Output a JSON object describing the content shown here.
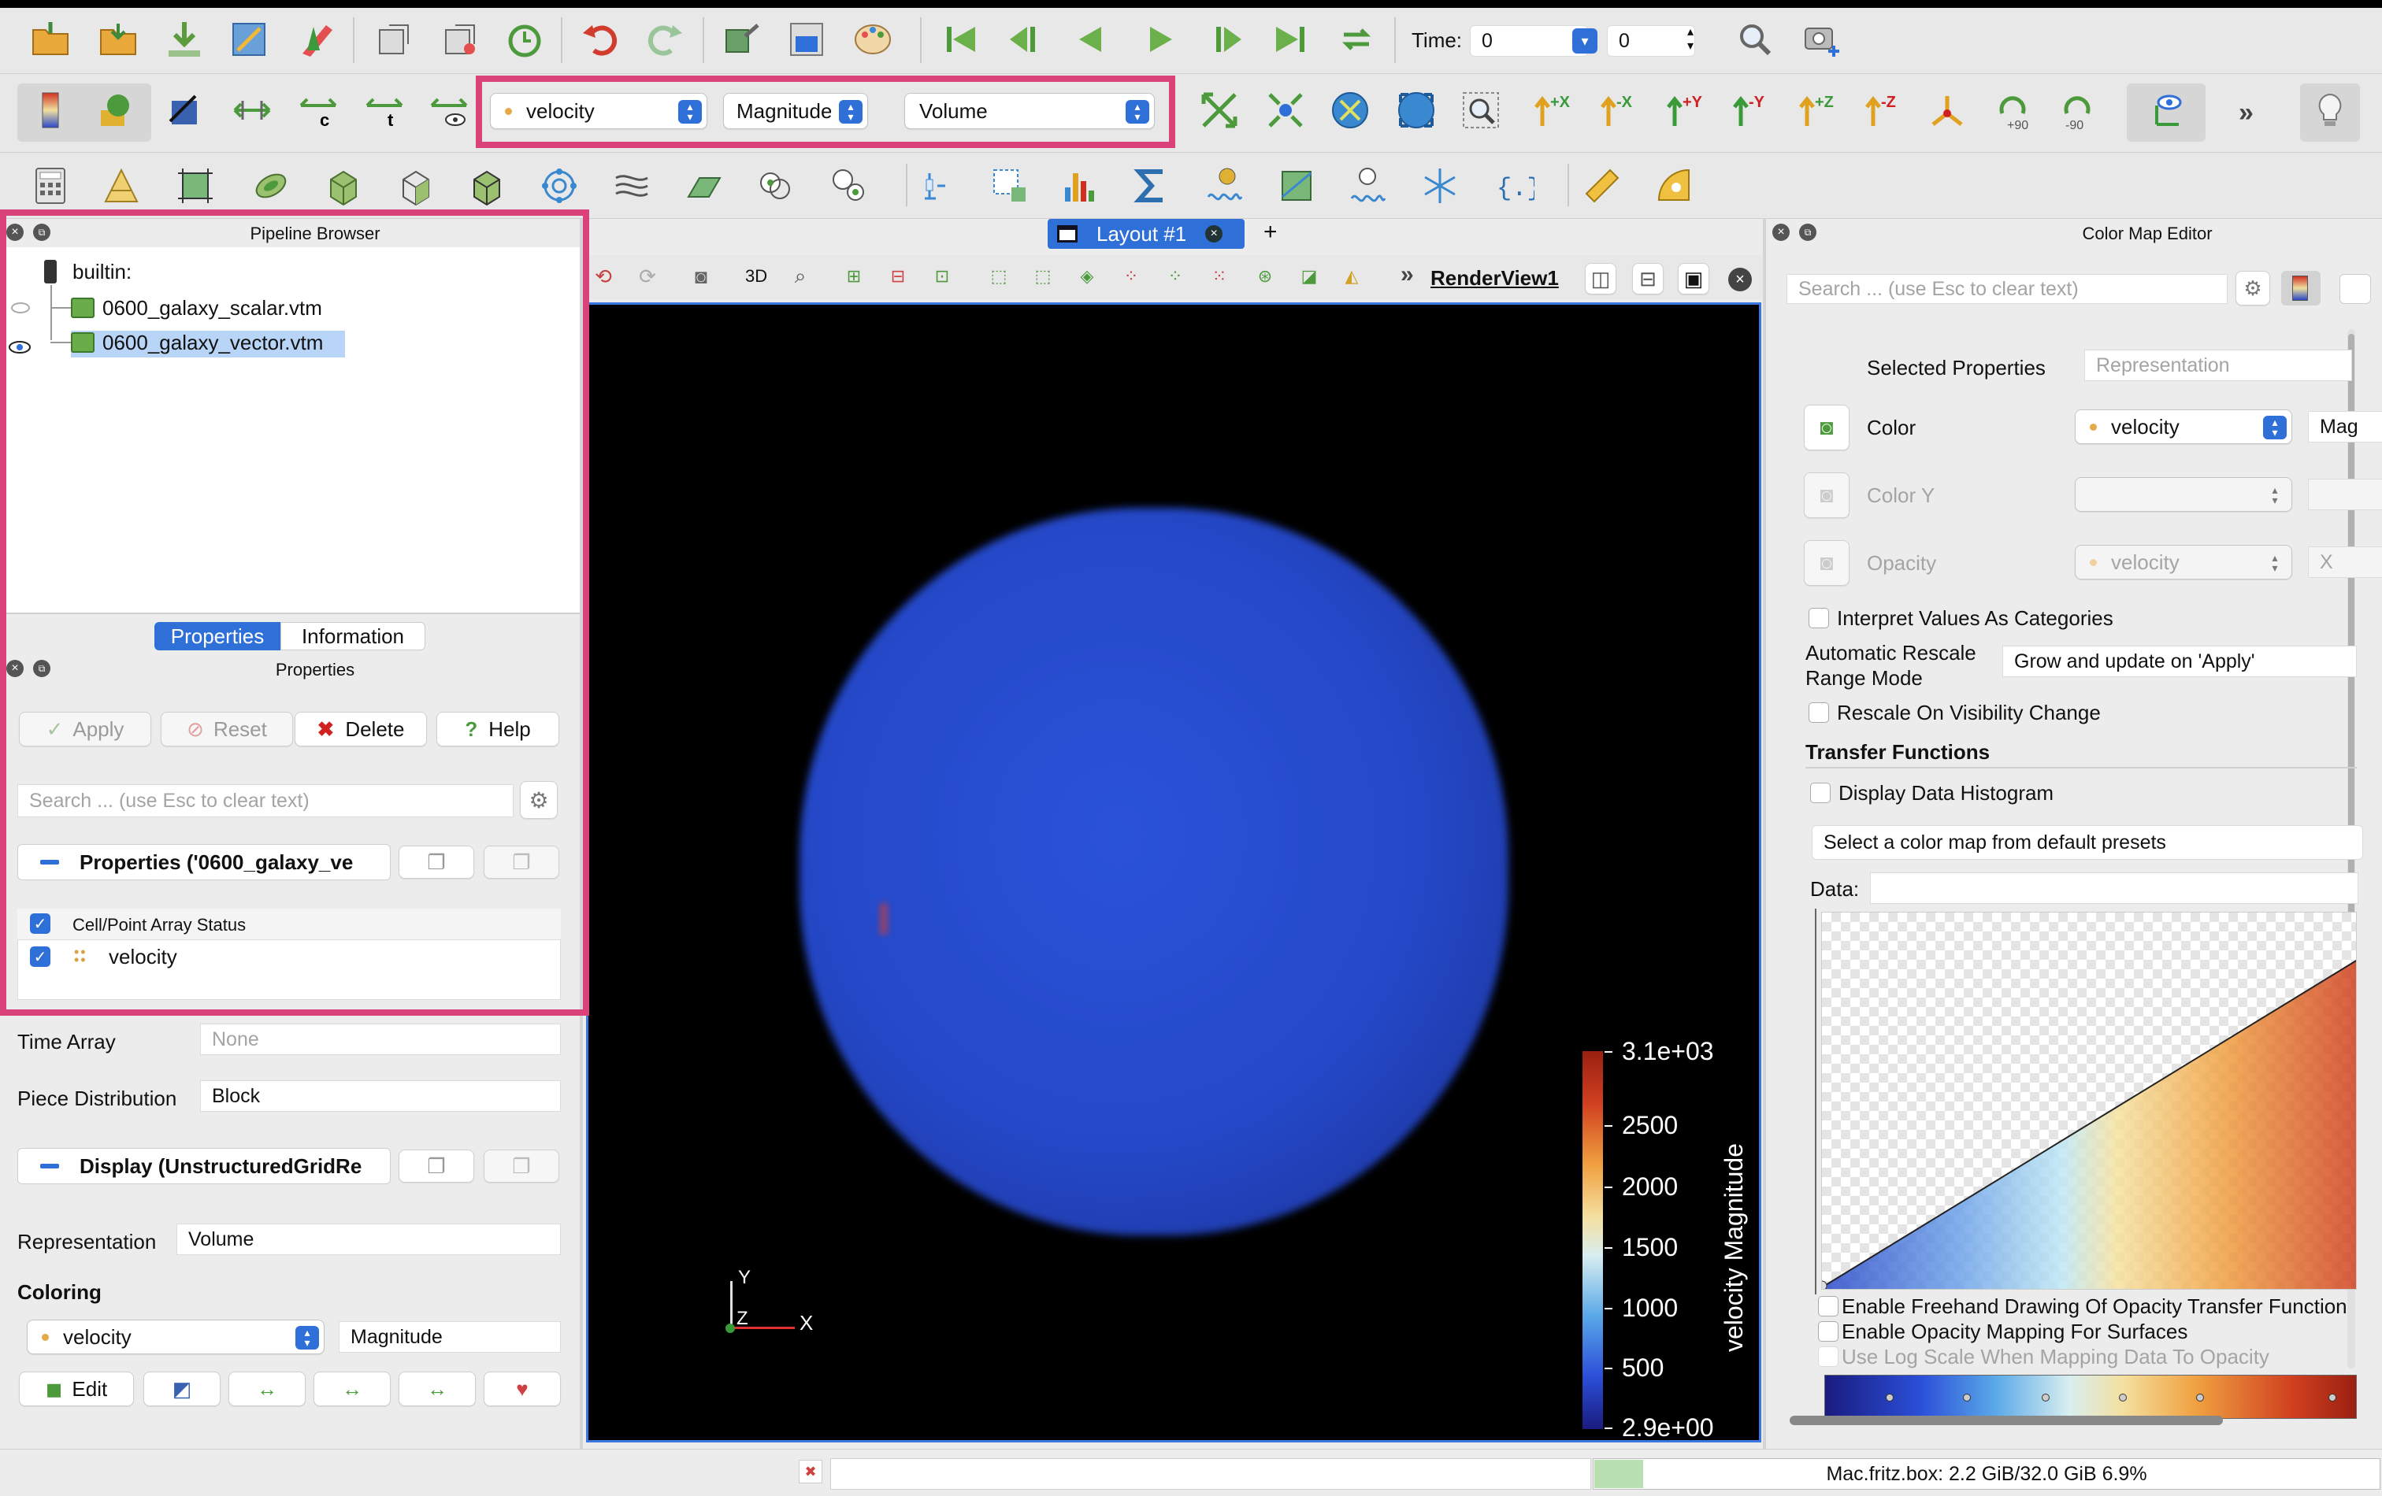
{
  "toolbar1": {
    "time_label": "Time:",
    "time_value": "0",
    "time_index": "0"
  },
  "toolbar2": {
    "array_combo": "velocity",
    "component_combo": "Magnitude",
    "representation_combo": "Volume"
  },
  "pipeline": {
    "title": "Pipeline Browser",
    "root": "builtin:",
    "items": [
      "0600_galaxy_scalar.vtm",
      "0600_galaxy_vector.vtm"
    ]
  },
  "tabs": [
    "Properties",
    "Information"
  ],
  "properties": {
    "title": "Properties",
    "apply": "Apply",
    "reset": "Reset",
    "delete": "Delete",
    "help": "Help",
    "search_placeholder": "Search ... (use Esc to clear text)",
    "section_header": "Properties ('0600_galaxy_ve",
    "array_status_header": "Cell/Point Array Status",
    "array_item": "velocity",
    "time_array_label": "Time Array",
    "time_array_value": "None",
    "piece_label": "Piece Distribution",
    "piece_value": "Block",
    "display_header": "Display (UnstructuredGridRe",
    "representation_label": "Representation",
    "representation_value": "Volume",
    "coloring_label": "Coloring",
    "coloring_array": "velocity",
    "coloring_component": "Magnitude",
    "edit_label": "Edit"
  },
  "layout": {
    "tab_label": "Layout #1",
    "add": "+",
    "view_toggle": "3D",
    "view_name": "RenderView1"
  },
  "colorbar": {
    "title": "velocity Magnitude",
    "ticks": [
      "3.1e+03",
      "2500",
      "2000",
      "1500",
      "1000",
      "500",
      "2.9e+00"
    ]
  },
  "axes": {
    "y": "Y",
    "z": "Z",
    "x": "X"
  },
  "cme": {
    "title": "Color Map Editor",
    "search_placeholder": "Search ... (use Esc to clear text)",
    "selected_properties": "Selected Properties",
    "representation_header": "Representation",
    "color_label": "Color",
    "color_value": "velocity",
    "color_component": "Mag",
    "color_y_label": "Color Y",
    "opacity_label": "Opacity",
    "opacity_value": "velocity",
    "opacity_component": "X",
    "interpret": "Interpret Values As Categories",
    "auto_rescale_1": "Automatic Rescale",
    "auto_rescale_2": "Range Mode",
    "auto_rescale_value": "Grow and update on 'Apply'",
    "rescale_visibility": "Rescale On Visibility Change",
    "transfer_functions": "Transfer Functions",
    "display_histogram": "Display Data Histogram",
    "preset": "Select a color map from default presets",
    "data_label": "Data:",
    "freehand": "Enable Freehand Drawing Of Opacity Transfer Function",
    "opacity_surfaces": "Enable Opacity Mapping For Surfaces",
    "log_scale": "Use Log Scale When Mapping Data To Opacity"
  },
  "status": {
    "memory": "Mac.fritz.box: 2.2 GiB/32.0 GiB 6.9%"
  }
}
